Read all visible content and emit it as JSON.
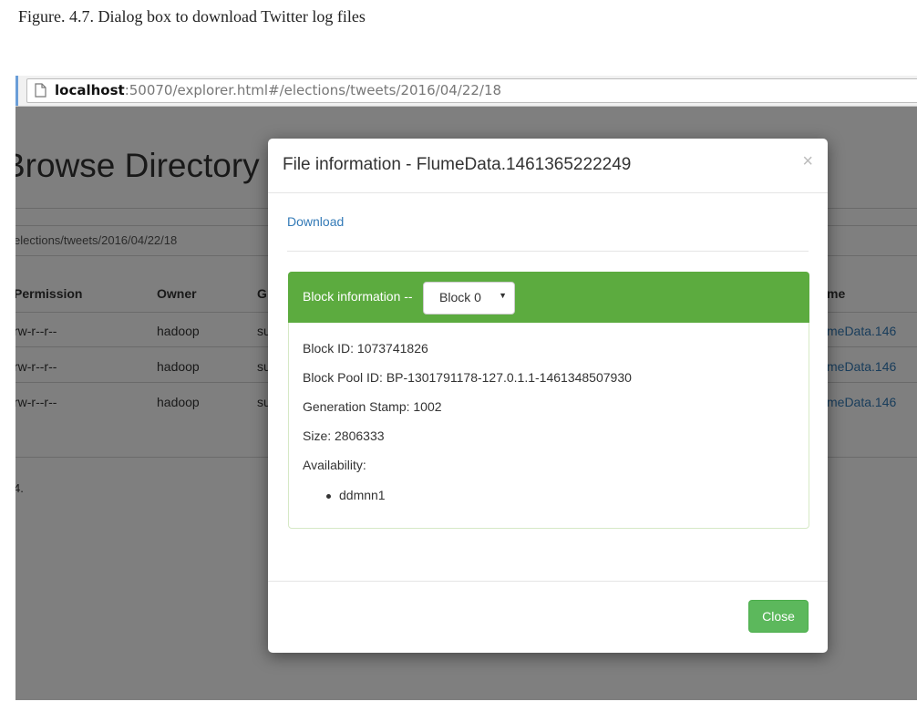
{
  "caption": "Figure. 4.7. Dialog box to download Twitter log files",
  "browser": {
    "url_host": "localhost",
    "url_rest": ":50070/explorer.html#/elections/tweets/2016/04/22/18",
    "page_icon": "page-icon"
  },
  "background_page": {
    "title": "Browse Directory",
    "path": "elections/tweets/2016/04/22/18",
    "columns": [
      "Permission",
      "Owner",
      "G",
      "me"
    ],
    "rows": [
      {
        "permission": "rw-r--r--",
        "owner": "hadoop",
        "group": "su",
        "name": "meData.146"
      },
      {
        "permission": "rw-r--r--",
        "owner": "hadoop",
        "group": "su",
        "name": "meData.146"
      },
      {
        "permission": "rw-r--r--",
        "owner": "hadoop",
        "group": "su",
        "name": "meData.146"
      }
    ],
    "footer": "4."
  },
  "modal": {
    "title": "File information - FlumeData.1461365222249",
    "close_icon": "×",
    "download_label": "Download",
    "block_panel": {
      "heading_label": "Block information --",
      "selected_block": "Block 0",
      "block_id": "Block ID: 1073741826",
      "block_pool_id": "Block Pool ID: BP-1301791178-127.0.1.1-1461348507930",
      "generation_stamp": "Generation Stamp: 1002",
      "size": "Size: 2806333",
      "availability_label": "Availability:",
      "availability": [
        "ddmnn1"
      ]
    },
    "close_button": "Close"
  },
  "colors": {
    "panel_heading": "#5cab3f",
    "close_button": "#5cb85c",
    "link": "#337ab7"
  }
}
